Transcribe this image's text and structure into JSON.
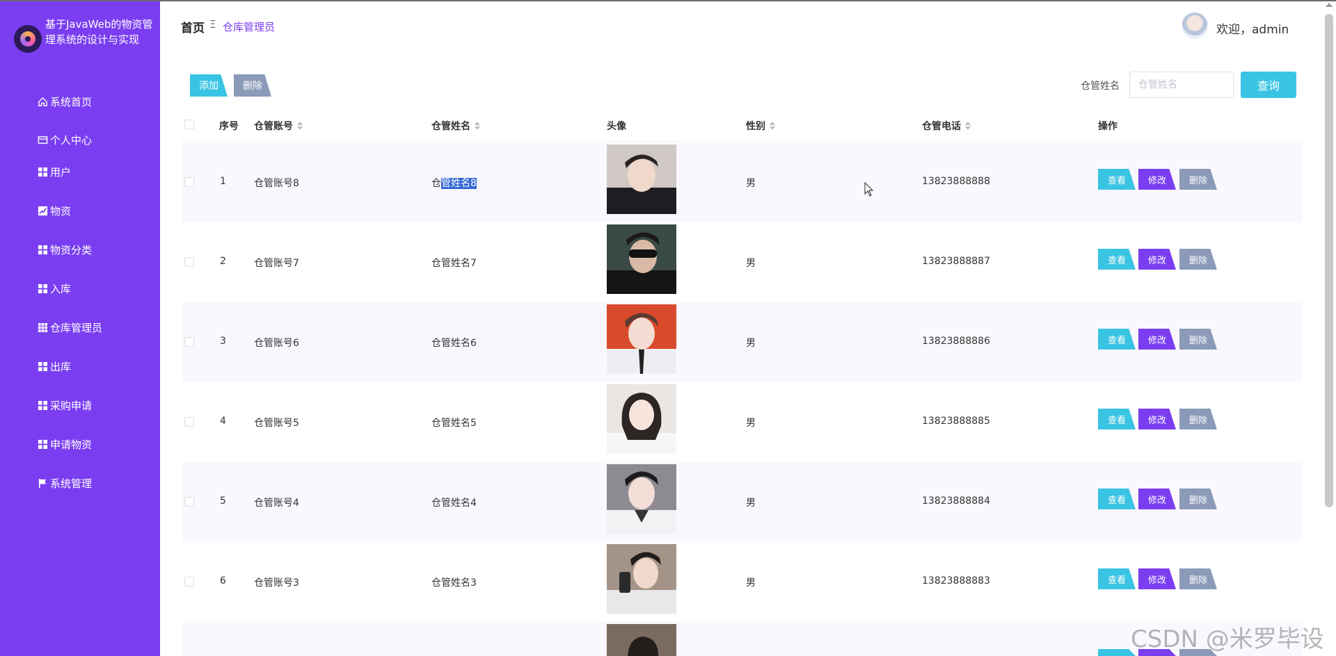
{
  "app": {
    "title": "基于JavaWeb的物资管理系统的设计与实现",
    "welcome": "欢迎，admin"
  },
  "breadcrumb": {
    "home": "首页",
    "separator": "Ξ",
    "current": "仓库管理员"
  },
  "sidebar": {
    "items": [
      {
        "label": "系统首页",
        "icon": "home-icon"
      },
      {
        "label": "个人中心",
        "icon": "card-icon"
      },
      {
        "label": "用户",
        "icon": "grid-icon"
      },
      {
        "label": "物资",
        "icon": "chart-icon"
      },
      {
        "label": "物资分类",
        "icon": "grid-icon"
      },
      {
        "label": "入库",
        "icon": "grid-icon"
      },
      {
        "label": "仓库管理员",
        "icon": "table-icon"
      },
      {
        "label": "出库",
        "icon": "grid-icon"
      },
      {
        "label": "采购申请",
        "icon": "grid-icon"
      },
      {
        "label": "申请物资",
        "icon": "grid-icon"
      },
      {
        "label": "系统管理",
        "icon": "flag-icon"
      }
    ]
  },
  "toolbar": {
    "add_label": "添加",
    "delete_label": "删除",
    "search_label": "仓管姓名",
    "search_placeholder": "仓管姓名",
    "query_label": "查询"
  },
  "table": {
    "columns": [
      "序号",
      "仓管账号",
      "仓管姓名",
      "头像",
      "性别",
      "仓管电话",
      "操作"
    ],
    "rows": [
      {
        "index": "1",
        "account": "仓管账号8",
        "name_prefix": "仓",
        "name_selected": "管姓名8",
        "gender": "男",
        "phone": "13823888888"
      },
      {
        "index": "2",
        "account": "仓管账号7",
        "name": "仓管姓名7",
        "gender": "男",
        "phone": "13823888887"
      },
      {
        "index": "3",
        "account": "仓管账号6",
        "name": "仓管姓名6",
        "gender": "男",
        "phone": "13823888886"
      },
      {
        "index": "4",
        "account": "仓管账号5",
        "name": "仓管姓名5",
        "gender": "男",
        "phone": "13823888885"
      },
      {
        "index": "5",
        "account": "仓管账号4",
        "name": "仓管姓名4",
        "gender": "男",
        "phone": "13823888884"
      },
      {
        "index": "6",
        "account": "仓管账号3",
        "name": "仓管姓名3",
        "gender": "男",
        "phone": "13823888883"
      }
    ],
    "actions": {
      "view": "查看",
      "edit": "修改",
      "delete": "删除"
    }
  },
  "watermark": "CSDN @米罗毕设",
  "colors": {
    "sidebar": "#7a3ef0",
    "cyan": "#3ac4e3",
    "gray": "#8b9ab8"
  }
}
